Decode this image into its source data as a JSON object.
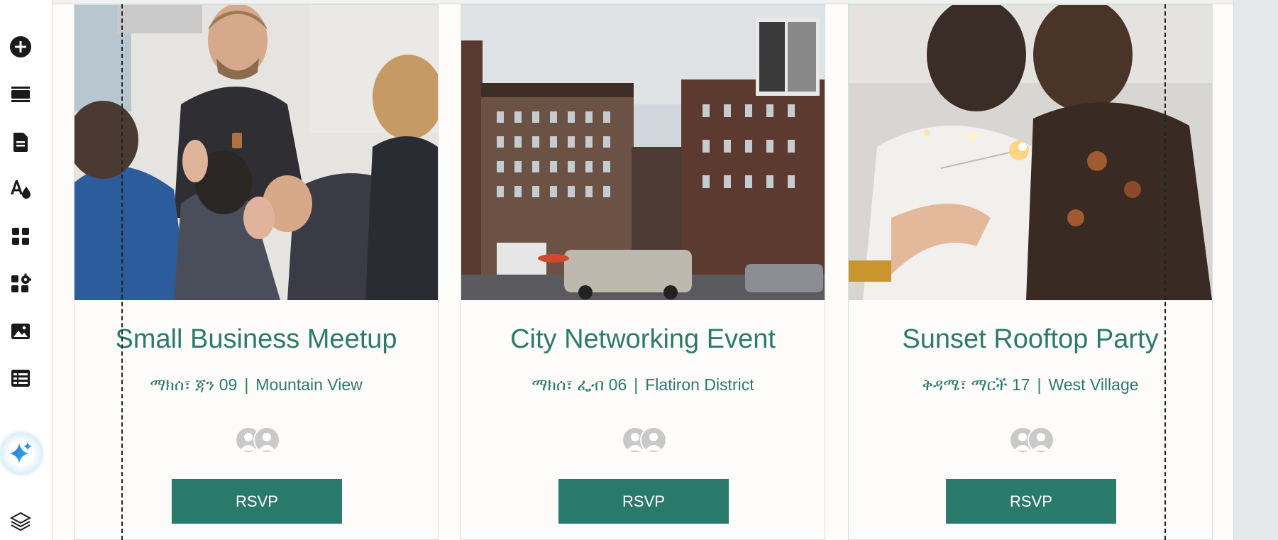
{
  "toolbar": {
    "items": [
      {
        "name": "add-elements",
        "icon": "plus-circle-icon"
      },
      {
        "name": "sections",
        "icon": "sections-icon"
      },
      {
        "name": "pages",
        "icon": "page-icon"
      },
      {
        "name": "site-design",
        "icon": "theme-icon"
      },
      {
        "name": "apps",
        "icon": "apps-grid-icon"
      },
      {
        "name": "add-apps",
        "icon": "puzzle-icon"
      },
      {
        "name": "media",
        "icon": "image-icon"
      },
      {
        "name": "cms",
        "icon": "table-icon"
      },
      {
        "name": "ai-assistant",
        "icon": "sparkle-icon"
      },
      {
        "name": "layers",
        "icon": "layers-icon"
      }
    ]
  },
  "colors": {
    "accent": "#2a7a6b",
    "title_text": "#2d7a6c",
    "card_border": "#cde4df",
    "toolbar_icon": "#1a1a1a"
  },
  "events": [
    {
      "title": "Small Business Meetup",
      "date": "ማክሰ፣ ጃን 09",
      "location": "Mountain View",
      "separator": "|",
      "button_label": "RSVP",
      "photo": "presenter-audience-photo"
    },
    {
      "title": "City Networking Event",
      "date": "ማክሰ፣ ፌብ 06",
      "location": "Flatiron District",
      "separator": "|",
      "button_label": "RSVP",
      "photo": "city-street-buildings-photo"
    },
    {
      "title": "Sunset Rooftop Party",
      "date": "ቅዳሜ፣ ማርች 17",
      "location": "West Village",
      "separator": "|",
      "button_label": "RSVP",
      "photo": "sparkler-couple-photo"
    }
  ]
}
